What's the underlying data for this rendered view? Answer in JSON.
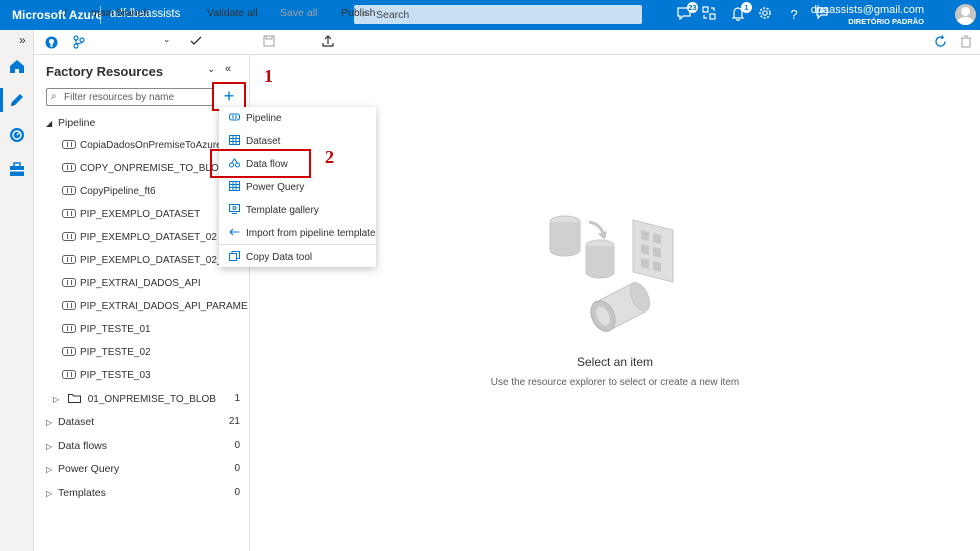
{
  "topbar": {
    "brand": "Microsoft Azure",
    "factory": "adfdbaassists",
    "search_placeholder": "Search",
    "notif_badge_feedback": "23",
    "notif_badge_bell": "1",
    "user_email": "dbaassists@gmail.com",
    "user_directory": "DIRETÓRIO PADRÃO"
  },
  "toolbar": {
    "branch": "main branch",
    "validate": "Validate all",
    "save": "Save all",
    "publish": "Publish",
    "slash": "/"
  },
  "panel": {
    "title": "Factory Resources",
    "filter_placeholder": "Filter resources by name",
    "categories": [
      {
        "label": "Pipeline",
        "count": ""
      },
      {
        "label": "Dataset",
        "count": "21"
      },
      {
        "label": "Data flows",
        "count": "0"
      },
      {
        "label": "Power Query",
        "count": "0"
      },
      {
        "label": "Templates",
        "count": "0"
      }
    ],
    "pipelines": [
      "CopiaDadosOnPremiseToAzureSQ",
      "COPY_ONPREMISE_TO_BLOB",
      "CopyPipeline_ft6",
      "PIP_EXEMPLO_DATASET",
      "PIP_EXEMPLO_DATASET_02",
      "PIP_EXEMPLO_DATASET_02_copy1",
      "PIP_EXTRAI_DADOS_API",
      "PIP_EXTRAI_DADOS_API_PARAMETRI...",
      "PIP_TESTE_01",
      "PIP_TESTE_02",
      "PIP_TESTE_03"
    ],
    "folder": {
      "label": "01_ONPREMISE_TO_BLOB",
      "count": "1"
    }
  },
  "menu": {
    "items": [
      "Pipeline",
      "Dataset",
      "Data flow",
      "Power Query",
      "Template gallery",
      "Import from pipeline template"
    ],
    "extra": "Copy Data tool"
  },
  "callouts": {
    "one": "1",
    "two": "2"
  },
  "empty": {
    "title": "Select an item",
    "subtitle": "Use the resource explorer to select or create a new item"
  },
  "colors": {
    "accent": "#0078d4",
    "highlight": "#d00000"
  }
}
